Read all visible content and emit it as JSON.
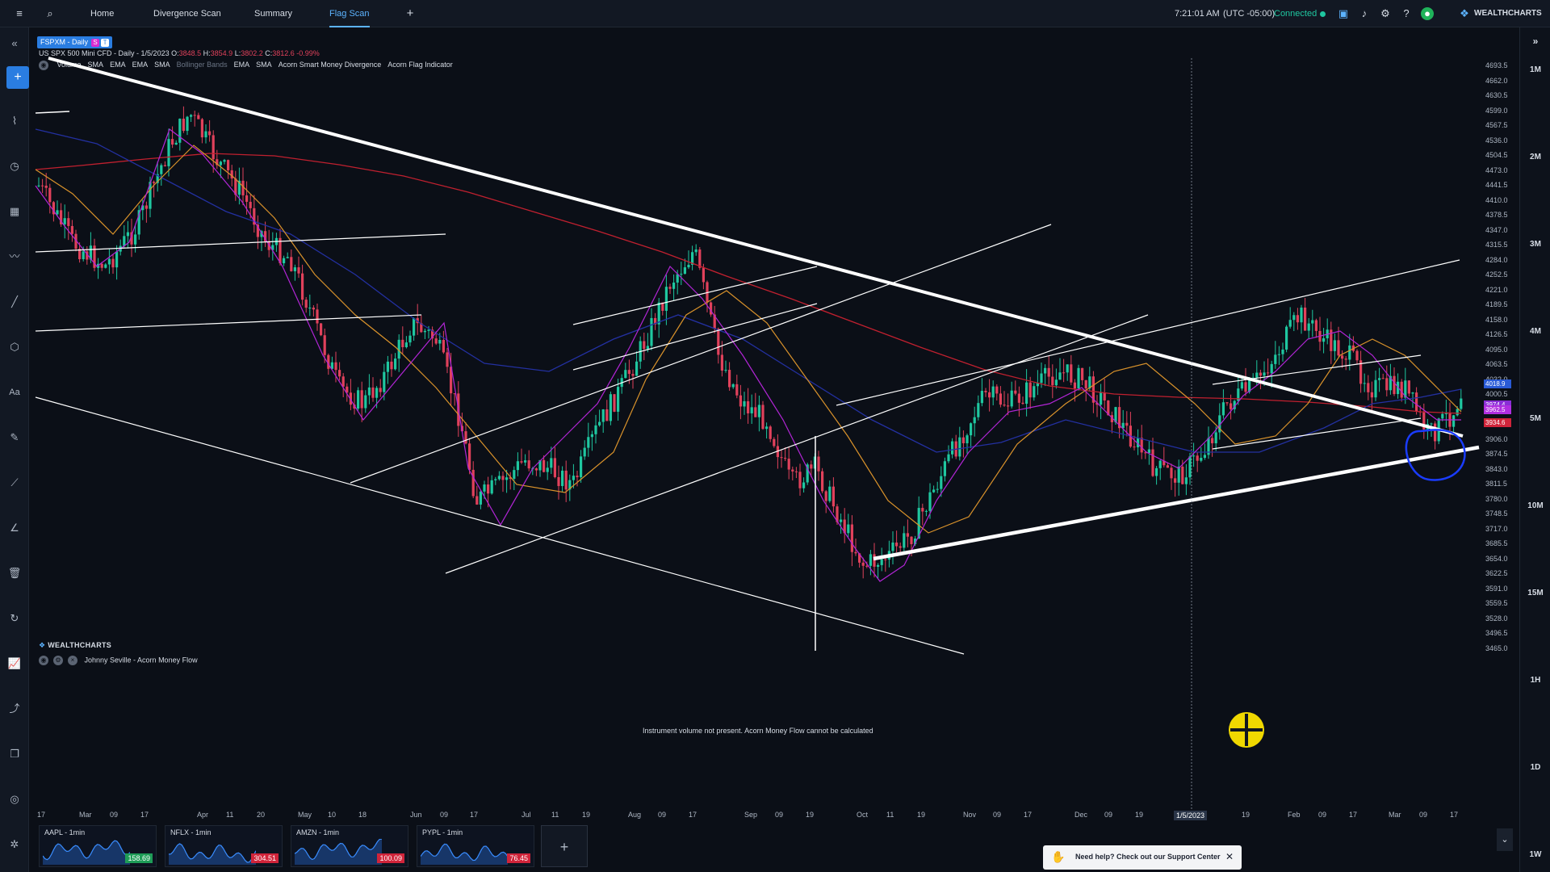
{
  "topbar": {
    "tabs": [
      {
        "label": "Home"
      },
      {
        "label": "Divergence Scan"
      },
      {
        "label": "Summary"
      },
      {
        "label": "Flag Scan"
      }
    ],
    "time": "7:21:01 AM",
    "timezone": "(UTC -05:00)",
    "connection": "Connected",
    "brand": "WEALTHCHARTS"
  },
  "chart": {
    "symbol": "FSPXM - Daily",
    "badge1": "S",
    "badge2": "T",
    "instrument": "US SPX 500 Mini CFD",
    "timeframe": "Daily",
    "date": "1/5/2023",
    "ohlc_o": "3848.5",
    "ohlc_h": "3854.9",
    "ohlc_l": "3802.2",
    "ohlc_c": "3812.6",
    "change": "-0.99%",
    "indicators": [
      "Volume",
      "SMA",
      "EMA",
      "EMA",
      "SMA",
      "Bollinger Bands",
      "EMA",
      "SMA",
      "Acorn Smart Money Divergence",
      "Acorn Flag Indicator"
    ],
    "price_labels": [
      "4693.5",
      "4662.0",
      "4630.5",
      "4599.0",
      "4567.5",
      "4536.0",
      "4504.5",
      "4473.0",
      "4441.5",
      "4410.0",
      "4378.5",
      "4347.0",
      "4315.5",
      "4284.0",
      "4252.5",
      "4221.0",
      "4189.5",
      "4158.0",
      "4126.5",
      "4095.0",
      "4063.5",
      "4032.0",
      "4000.5",
      "3969.0",
      "3937.5",
      "3906.0",
      "3874.5",
      "3843.0",
      "3811.5",
      "3780.0",
      "3748.5",
      "3717.0",
      "3685.5",
      "3654.0",
      "3622.5",
      "3591.0",
      "3559.5",
      "3528.0",
      "3496.5",
      "3465.0"
    ],
    "price_tags": [
      {
        "value": "4018.9",
        "color": "#2a5bd6"
      },
      {
        "value": "3974.4",
        "color": "#8a2ed6"
      },
      {
        "value": "3962.5",
        "color": "#b02ee0"
      },
      {
        "value": "3934.6",
        "color": "#d0243a"
      }
    ],
    "date_labels": [
      "17",
      "Mar",
      "09",
      "17",
      "Apr",
      "11",
      "20",
      "May",
      "10",
      "18",
      "Jun",
      "09",
      "17",
      "Jul",
      "11",
      "19",
      "Aug",
      "09",
      "17",
      "Sep",
      "09",
      "19",
      "Oct",
      "11",
      "19",
      "Nov",
      "09",
      "17",
      "Dec",
      "09",
      "19",
      "1/5/2023",
      "19",
      "Feb",
      "09",
      "17",
      "Mar",
      "09",
      "17"
    ],
    "crosshair_date": "1/5/2023"
  },
  "right_toolbar": {
    "timeframes": [
      "1M",
      "2M",
      "3M",
      "4M",
      "5M",
      "10M",
      "15M",
      "1H",
      "1D",
      "1W"
    ]
  },
  "lower_panel": {
    "brand": "WEALTHCHARTS",
    "title": "Johnny Seville - Acorn Money Flow",
    "message": "Instrument volume not present. Acorn Money Flow cannot be calculated"
  },
  "watchlist": [
    {
      "name": "AAPL - 1min",
      "price": "158.69",
      "color": "#1e9c57"
    },
    {
      "name": "NFLX - 1min",
      "price": "304.51",
      "color": "#d0243a"
    },
    {
      "name": "AMZN - 1min",
      "price": "100.09",
      "color": "#d0243a"
    },
    {
      "name": "PYPL - 1min",
      "price": "76.45",
      "color": "#d0243a"
    }
  ],
  "help": {
    "text": "Need help? Check out our Support Center"
  }
}
